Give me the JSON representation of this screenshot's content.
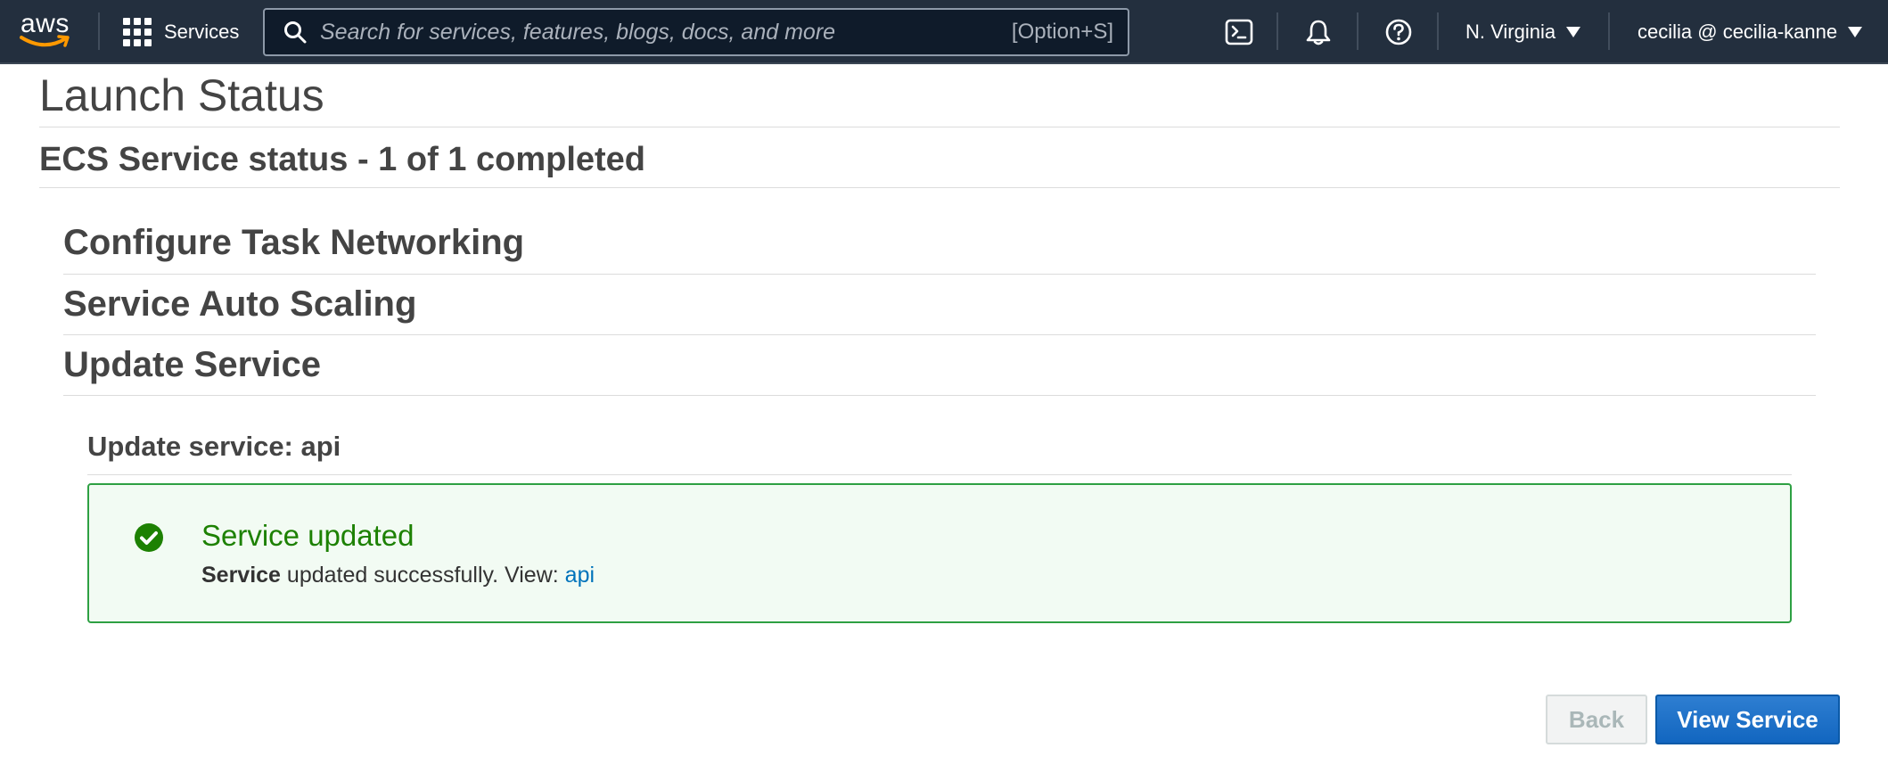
{
  "topnav": {
    "logo_text": "aws",
    "services_label": "Services",
    "search": {
      "placeholder": "Search for services, features, blogs, docs, and more",
      "value": "",
      "shortcut": "[Option+S]"
    },
    "region_label": "N. Virginia",
    "account_label": "cecilia @ cecilia-kanne",
    "icons": [
      "cloudshell-icon",
      "bell-icon",
      "help-icon"
    ]
  },
  "page": {
    "title": "Launch Status",
    "status_heading": "ECS Service status - 1 of 1 completed",
    "steps": [
      {
        "label": "Configure Task Networking"
      },
      {
        "label": "Service Auto Scaling"
      },
      {
        "label": "Update Service"
      }
    ],
    "update_heading": "Update service: api"
  },
  "alert": {
    "icon": "check-circle-icon",
    "title": "Service updated",
    "message_bold": "Service",
    "message_text": " updated successfully. View: ",
    "link_text": "api"
  },
  "actions": {
    "back_label": "Back",
    "view_label": "View Service"
  },
  "colors": {
    "nav_bg": "#232f3e",
    "success_green": "#1d8102",
    "success_bg": "#f2fbf3",
    "link_blue": "#0073bb",
    "primary_button": "#1266c0"
  }
}
